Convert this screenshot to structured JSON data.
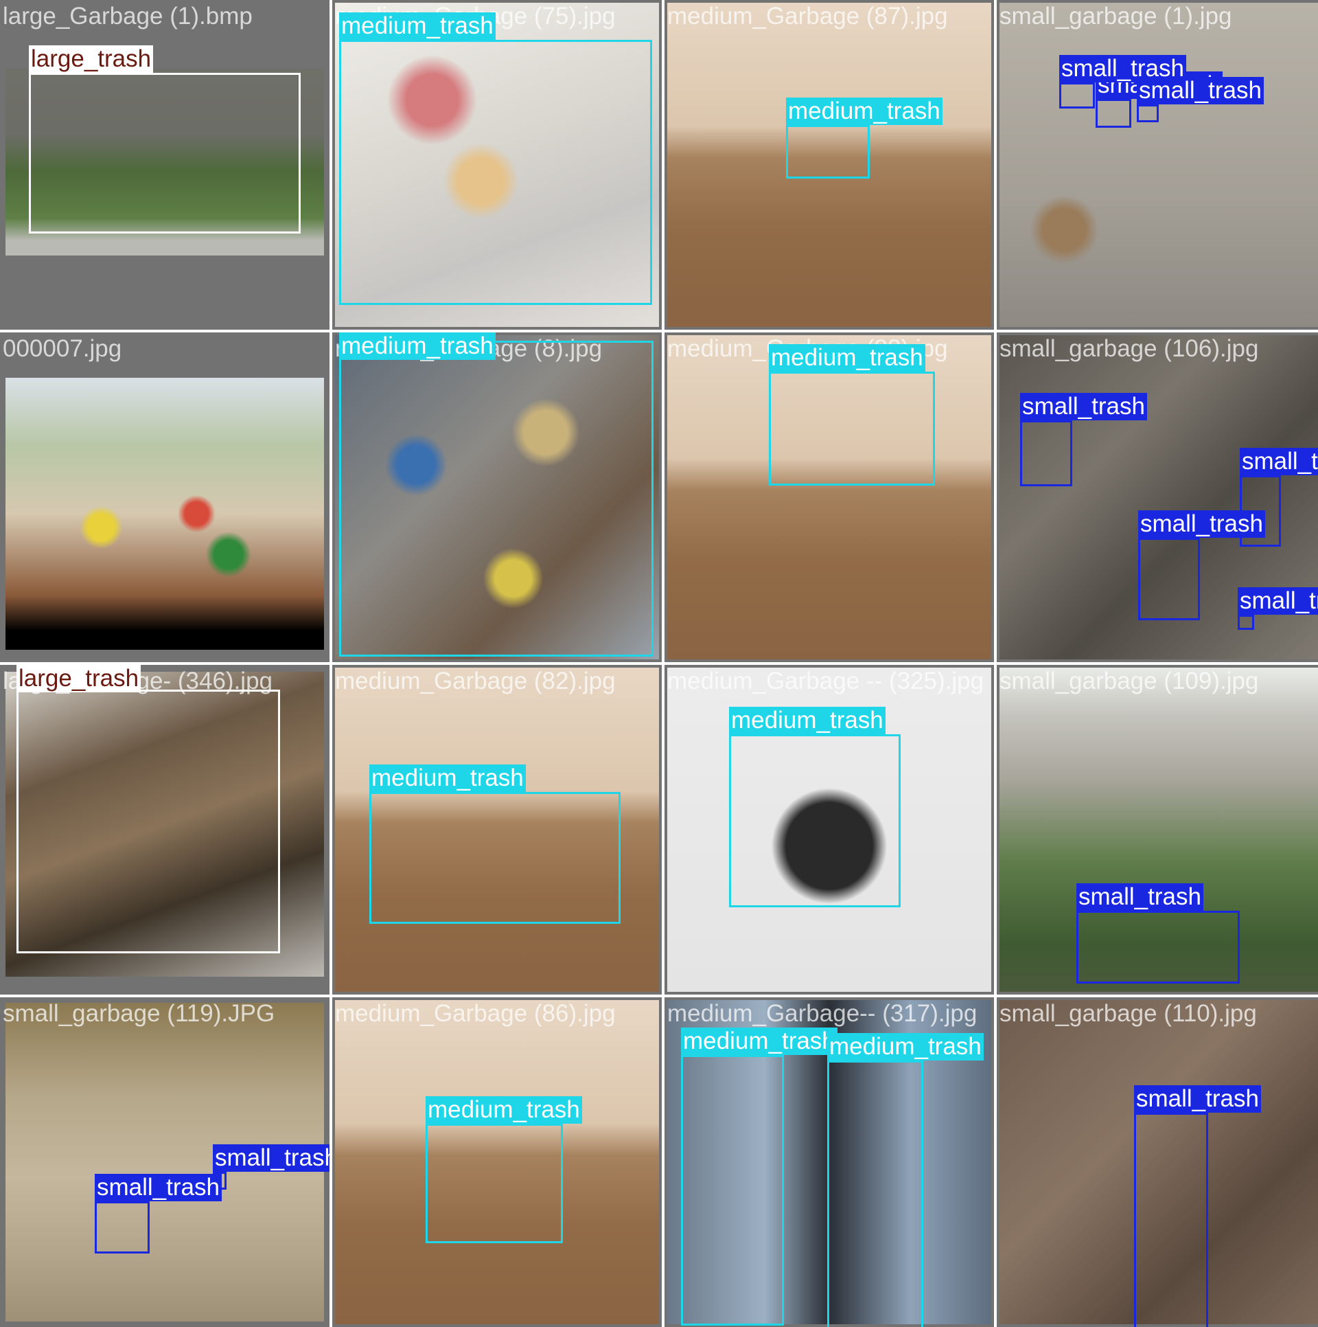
{
  "class_colors": {
    "large_trash": "#ffffff",
    "medium_trash": "#1fd6e8",
    "small_trash": "#1a27e0"
  },
  "tiles": [
    {
      "filename": "large_Garbage (1).bmp",
      "scene": "lawn",
      "detections": [
        {
          "label": "large_trash",
          "cls": "large"
        }
      ]
    },
    {
      "filename": "medium_Garbage (75).jpg",
      "scene": "paper",
      "detections": [
        {
          "label": "medium_trash",
          "cls": "medium"
        }
      ]
    },
    {
      "filename": "medium_Garbage (87).jpg",
      "scene": "floor",
      "detections": [
        {
          "label": "medium_trash",
          "cls": "medium"
        }
      ]
    },
    {
      "filename": "small_garbage (1).jpg",
      "scene": "concrete",
      "detections": [
        {
          "label": "small_trash",
          "cls": "small"
        },
        {
          "label": "small_trash",
          "cls": "small"
        },
        {
          "label": "small_trash",
          "cls": "small"
        }
      ]
    },
    {
      "filename": "000007.jpg",
      "scene": "cans",
      "detections": []
    },
    {
      "filename": "medium_Garbage (8).jpg",
      "scene": "pile",
      "detections": [
        {
          "label": "medium_trash",
          "cls": "medium"
        }
      ]
    },
    {
      "filename": "medium_Garbage (88).jpg",
      "scene": "floor",
      "detections": [
        {
          "label": "medium_trash",
          "cls": "medium"
        }
      ]
    },
    {
      "filename": "small_garbage (106).jpg",
      "scene": "ground",
      "detections": [
        {
          "label": "small_trash",
          "cls": "small"
        },
        {
          "label": "small_trash",
          "cls": "small"
        },
        {
          "label": "small_trash",
          "cls": "small"
        },
        {
          "label": "small_trash",
          "cls": "small"
        }
      ]
    },
    {
      "filename": "large_Garbage- (346).jpg",
      "scene": "wood",
      "detections": [
        {
          "label": "large_trash",
          "cls": "large"
        }
      ]
    },
    {
      "filename": "medium_Garbage (82).jpg",
      "scene": "floor",
      "detections": [
        {
          "label": "medium_trash",
          "cls": "medium"
        }
      ]
    },
    {
      "filename": "medium_Garbage -- (325).jpg",
      "scene": "drawing",
      "detections": [
        {
          "label": "medium_trash",
          "cls": "medium"
        }
      ]
    },
    {
      "filename": "small_garbage (109).jpg",
      "scene": "lake",
      "detections": [
        {
          "label": "small_trash",
          "cls": "small"
        }
      ]
    },
    {
      "filename": "small_garbage (119).JPG",
      "scene": "shore",
      "detections": [
        {
          "label": "small_trash",
          "cls": "small"
        },
        {
          "label": "small_trash",
          "cls": "small"
        }
      ]
    },
    {
      "filename": "medium_Garbage (86).jpg",
      "scene": "floor",
      "detections": [
        {
          "label": "medium_trash",
          "cls": "medium"
        }
      ]
    },
    {
      "filename": "medium_Garbage-- (317).jpg",
      "scene": "bins",
      "detections": [
        {
          "label": "medium_trash",
          "cls": "medium"
        },
        {
          "label": "medium_trash",
          "cls": "medium"
        }
      ]
    },
    {
      "filename": "small_garbage (110).jpg",
      "scene": "leaves",
      "detections": [
        {
          "label": "small_trash",
          "cls": "small"
        }
      ]
    }
  ]
}
